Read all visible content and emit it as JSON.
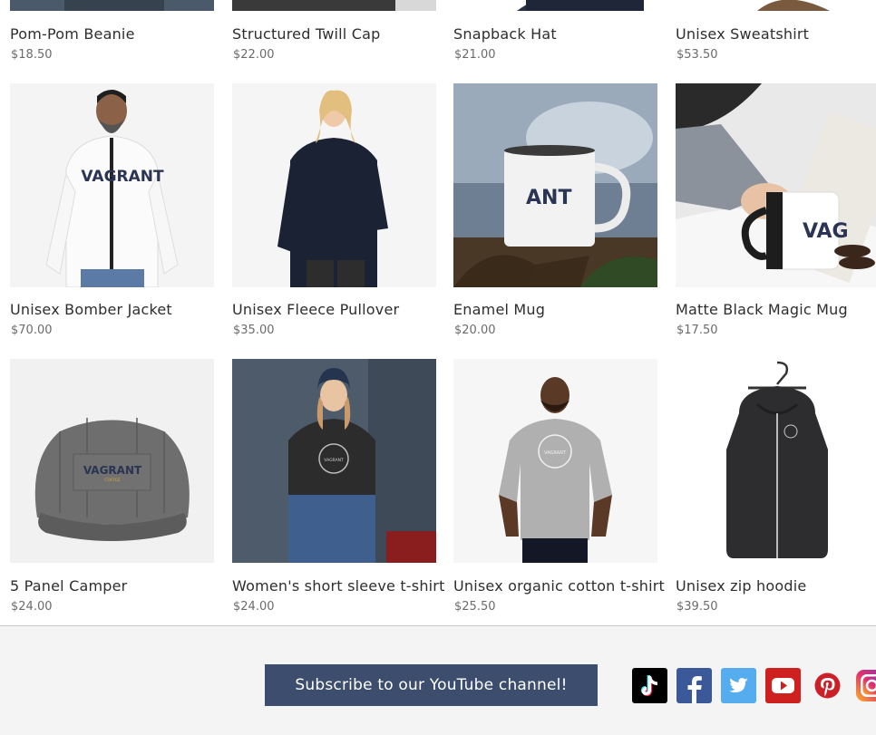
{
  "products": {
    "row0": [
      {
        "name": "Pom-Pom Beanie",
        "price": "$18.50"
      },
      {
        "name": "Structured Twill Cap",
        "price": "$22.00"
      },
      {
        "name": "Snapback Hat",
        "price": "$21.00"
      },
      {
        "name": "Unisex Sweatshirt",
        "price": "$53.50"
      }
    ],
    "row1": [
      {
        "name": "Unisex Bomber Jacket",
        "price": "$70.00",
        "print": "VAGRANT"
      },
      {
        "name": "Unisex Fleece Pullover",
        "price": "$35.00"
      },
      {
        "name": "Enamel Mug",
        "price": "$20.00",
        "print": "ANT"
      },
      {
        "name": "Matte Black Magic Mug",
        "price": "$17.50",
        "print": "VAG"
      }
    ],
    "row2": [
      {
        "name": "5 Panel Camper",
        "price": "$24.00",
        "print": "VAGRANT",
        "print_sub": "COFFEE"
      },
      {
        "name": "Women's short sleeve t-shirt",
        "price": "$24.00",
        "print": "VAGRANT"
      },
      {
        "name": "Unisex organic cotton t-shirt",
        "price": "$25.50",
        "print": "VAGRANT"
      },
      {
        "name": "Unisex zip hoodie",
        "price": "$39.50"
      }
    ]
  },
  "footer": {
    "subscribe_label": "Subscribe to our YouTube channel!"
  },
  "social": [
    {
      "icon": "tiktok-icon",
      "color": "#000000"
    },
    {
      "icon": "facebook-icon",
      "color": "#3b5998"
    },
    {
      "icon": "twitter-icon",
      "color": "#55acee"
    },
    {
      "icon": "youtube-icon",
      "color": "#cd201f"
    },
    {
      "icon": "pinterest-icon",
      "color": "#cb2027"
    },
    {
      "icon": "instagram-icon",
      "color": "#c13584"
    }
  ],
  "colors": {
    "subscribe_bg": "#3d4d6e",
    "footer_bg": "#f4f4f4",
    "brand_navy": "#2a3454",
    "brand_gold": "#d4a53a"
  }
}
